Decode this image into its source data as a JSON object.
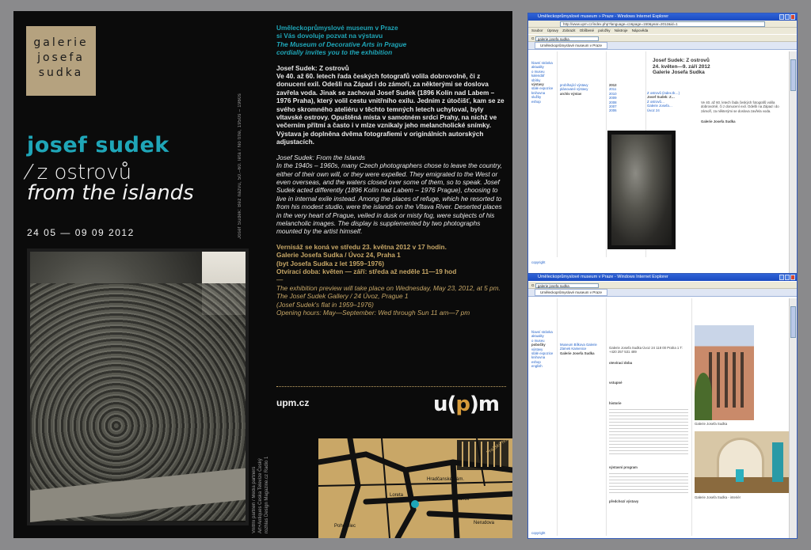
{
  "card": {
    "logo": [
      "galerie",
      "josefa",
      "sudka"
    ],
    "artist": "josef sudek",
    "title_cz": "⁄ z ostrovů",
    "title_en": "from the islands",
    "dates": "24 05 — 09 09 2012",
    "vertical_caption": "Josef Sudek: Bez názvu, 50.–60. léta / No title, 1950s – 1960s",
    "intro_cz_1": "Uměleckoprůmyslové museum v Praze",
    "intro_cz_2": "si Vás dovoluje pozvat na výstavu",
    "intro_en_1": "The Museum of Decorative Arts in Prague",
    "intro_en_2": "cordially invites you to the exhibition",
    "cz_heading": "Josef Sudek: Z ostrovů",
    "cz_body": "Ve 40. až 60. letech řada českých fotografů volila dobrovolně, či z donucení exil. Odešli na Západ i do zámoří, za některými se doslova zavřela voda. Jinak se zachoval Josef Sudek (1896 Kolín nad Labem – 1976 Praha), který volil cestu vnitřního exilu. Jedním z útočišť, kam se ze svého skromného ateliéru v těchto temných letech uchyloval, byly vltavské ostrovy. Opuštěná místa v samotném srdci Prahy, na nichž ve večerním přítmí a často i v mlze vznikaly jeho melancholické snímky. Výstava je doplněna dvěma fotografiemi v originálních autorských adjustacích.",
    "en_heading": "Josef Sudek: From the Islands",
    "en_body": "In the 1940s – 1960s, many Czech photographers chose to leave the country, either of their own will, or they were expelled. They emigrated to the West or even overseas, and the waters closed over some of them, so to speak. Josef Sudek acted differently (1896 Kolín nad Labem – 1976 Prague), choosing to live in internal exile instead. Among the places of refuge, which he resorted to from his modest studio, were the islands on the Vltava River. Deserted places in the very heart of Prague, veiled in dusk or misty fog, were subjects of his melancholic images. The display is supplemented by two photographs mounted by the artist himself.",
    "vernisage_cz": "Vernisáž se koná ve středu 23. května 2012 v 17 hodin.",
    "gallery_cz": "Galerie Josefa Sudka / Úvoz 24, Praha 1",
    "flat_cz": "(byt Josefa Sudka z let 1959–1976)",
    "hours_cz": "Otvírací doba: květen — září: středa až neděle 11—19 hod",
    "dash": "—",
    "preview_en": "The exhibition preview will take place on Wednesday, May 23, 2012, at 5 pm.",
    "gallery_en": "The Josef Sudek Gallery / 24 Úvoz, Prague 1",
    "flat_en": "(Josef Sudek's flat in 1959–1976)",
    "hours_en": "Opening hours: May—September: Wed through Sun 11 am—7 pm",
    "url": "upm.cz",
    "upm_pre": "u(",
    "upm_p": "p",
    "upm_post": ")m",
    "credits": "Vnitřní partneři / Media partners Art+Antiques Ceska Televize Český rozhlas Design Magazine.cz Radio 1",
    "map_labels": [
      "Pohořelec",
      "Loreta",
      "Hradčanské nám.",
      "Pražský hrad",
      "Nerudova",
      "Strahov"
    ]
  },
  "browser1": {
    "title": "Uměleckoprůmyslové museum » Praze - Windows Internet Explorer",
    "address": "http://www.upm.cz/index.php?language=cz&page=150&year=2012&id=1",
    "menu": "Soubor Úpravy Zobrazit Oblíbené položky Nástroje Nápověda",
    "google": "galerie josefa sudka",
    "tab": "Uměleckoprůmyslové museum v Praze",
    "heading_1": "Josef Sudek: Z ostrovů",
    "heading_2": "24. květen—9. září 2012",
    "heading_3": "Galerie Josefa Sudka",
    "left_links": [
      "hlavní stránka",
      "aktuality",
      "o museu",
      "kalendář",
      "sbírky",
      "výstavy",
      "stálé expozice",
      "knihovna",
      "služby",
      "eshop"
    ],
    "mid_links": [
      "probíhající výstavy",
      "plánované výstavy",
      "archiv výstav"
    ],
    "years": [
      "2012",
      "2011",
      "2010",
      "2009",
      "2008",
      "2007",
      "2006"
    ],
    "side_links": [
      "Z ostrovů (index.tk…)",
      "Josef Sudek: Z…",
      "Z ostrovů…",
      "Galerie Josefa…",
      "Úvoz 24"
    ],
    "right_text": "Ve 40. až 60. letech řada českých fotografů volila dobrovolně, či z donucení exil. Odešli na Západ i do zámoří, za některými se doslova zavřela voda.",
    "info_title": "Galerie Josefa Sudka",
    "footer": "copyright"
  },
  "browser2": {
    "title": "Uměleckoprůmyslové museum v Praze - Windows Internet Explorer",
    "google": "galerie josefa sudka",
    "tab": "Uměleckoprůmyslové museum v Praze",
    "left_links": [
      "hlavní stránka",
      "aktuality",
      "o museu",
      "pobočky",
      "výstavy",
      "stálé expozice",
      "knihovna",
      "eshop",
      "english"
    ],
    "mid_links": [
      "Museum Bílkova Galerie",
      "Zámek Kamenice",
      "Galerie Josefa Sudka"
    ],
    "address_block": "Galerie Josefa Sudka Úvoz 24 118 00 Praha 1 T: +420 257 531 489",
    "hours_label": "otevírací doba",
    "visit_label": "vstupné",
    "history_label": "historie",
    "program_label": "výstavní program",
    "previous_label": "předchozí výstavy",
    "photo_caption_1": "Galerie Josefa Sudka",
    "photo_caption_2": "Galerie Josefa Sudka - interiér",
    "footer": "copyright"
  }
}
